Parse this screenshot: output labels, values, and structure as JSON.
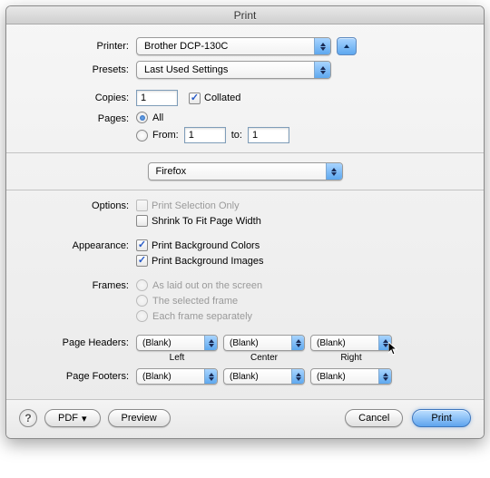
{
  "window": {
    "title": "Print"
  },
  "printer": {
    "label": "Printer:",
    "value": "Brother DCP-130C"
  },
  "presets": {
    "label": "Presets:",
    "value": "Last Used Settings"
  },
  "copies": {
    "label": "Copies:",
    "value": "1",
    "collated_label": "Collated",
    "collated": true
  },
  "pages": {
    "label": "Pages:",
    "all_label": "All",
    "all_selected": true,
    "from_label": "From:",
    "to_label": "to:",
    "from_value": "1",
    "to_value": "1"
  },
  "app_select": {
    "value": "Firefox"
  },
  "options": {
    "label": "Options:",
    "selection_label": "Print Selection Only",
    "selection_checked": false,
    "shrink_label": "Shrink To Fit Page Width",
    "shrink_checked": false
  },
  "appearance": {
    "label": "Appearance:",
    "bgcolors_label": "Print Background Colors",
    "bgcolors_checked": true,
    "bgimages_label": "Print Background Images",
    "bgimages_checked": true
  },
  "frames": {
    "label": "Frames:",
    "opt1": "As laid out on the screen",
    "opt2": "The selected frame",
    "opt3": "Each frame separately"
  },
  "page_headers": {
    "label": "Page Headers:"
  },
  "page_footers": {
    "label": "Page Footers:"
  },
  "hf": {
    "left_label": "Left",
    "center_label": "Center",
    "right_label": "Right",
    "blank_value": "(Blank)"
  },
  "footer": {
    "pdf_label": "PDF",
    "preview_label": "Preview",
    "cancel_label": "Cancel",
    "print_label": "Print"
  }
}
